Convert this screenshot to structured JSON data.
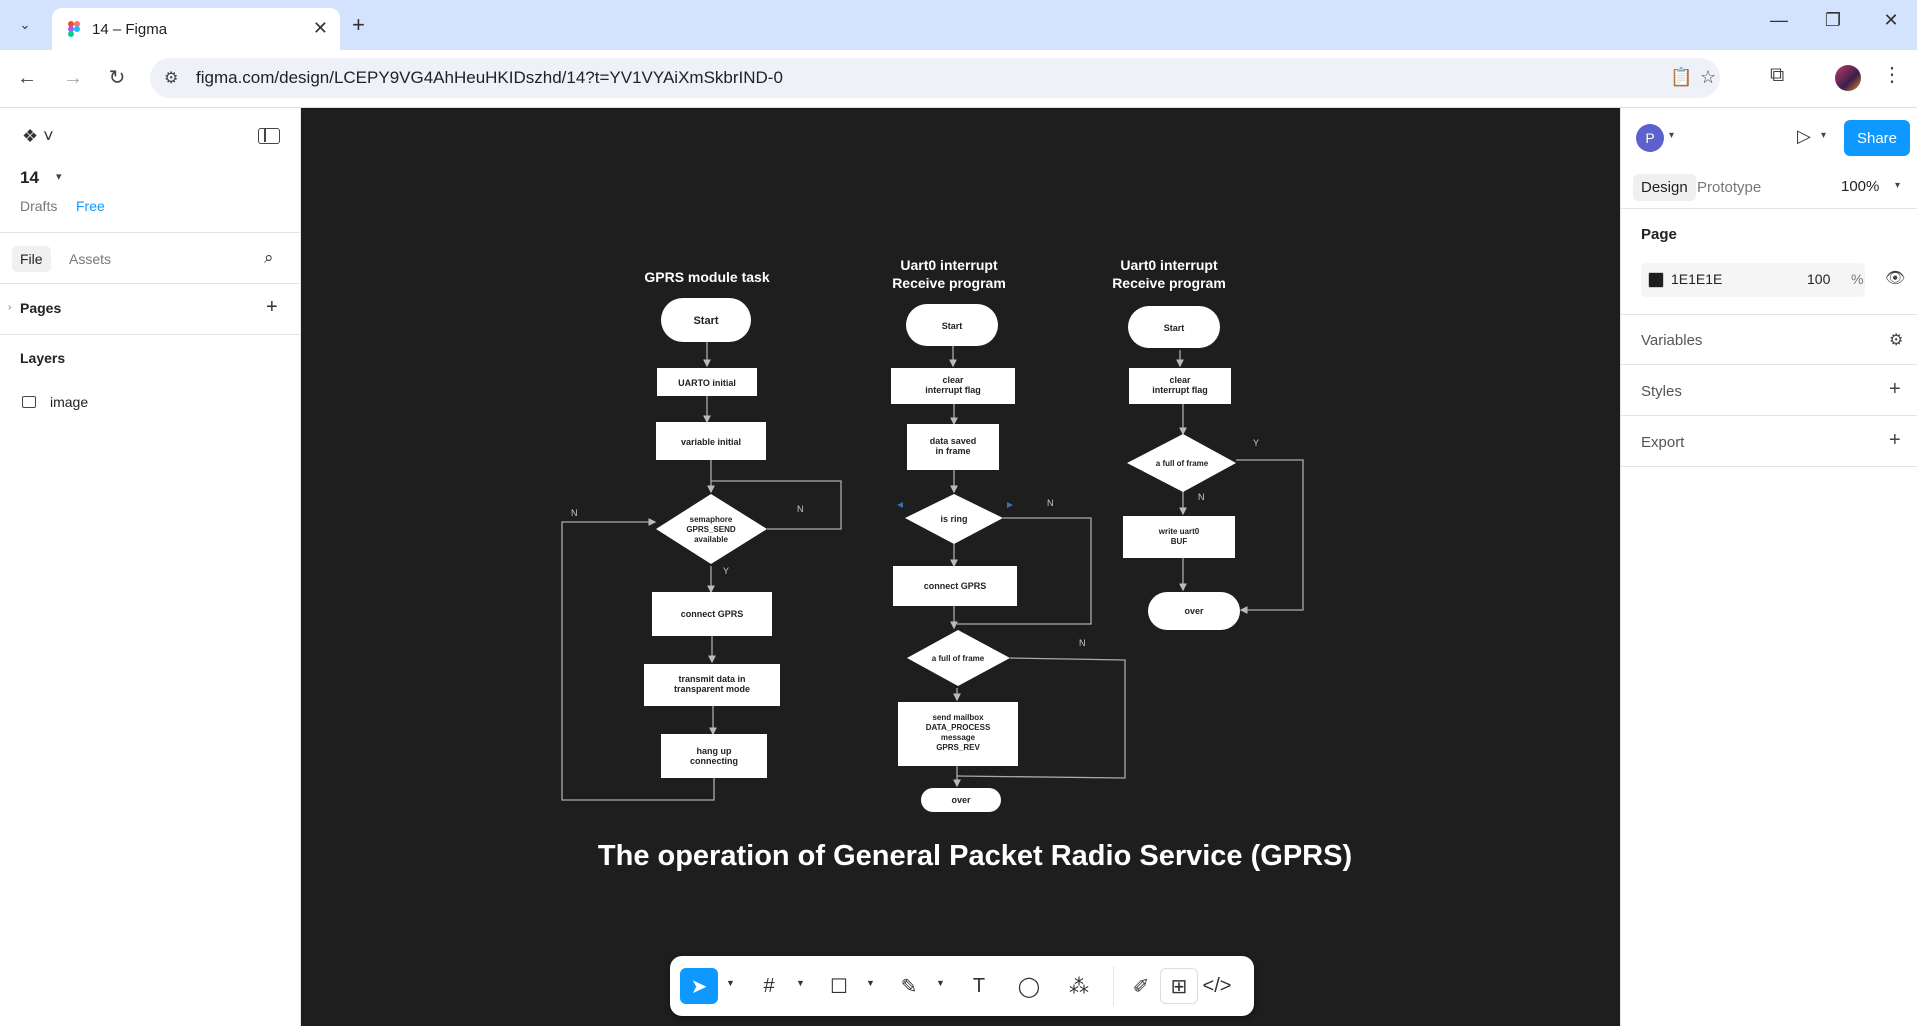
{
  "browser": {
    "tab_title": "14 – Figma",
    "url": "figma.com/design/LCEPY9VG4AhHeuHKIDszhd/14?t=YV1VYAiXmSkbrIND-0"
  },
  "left_panel": {
    "file_name": "14",
    "location": "Drafts",
    "plan": "Free",
    "tabs": [
      "File",
      "Assets"
    ],
    "pages_label": "Pages",
    "layers_label": "Layers",
    "layers": [
      "image"
    ]
  },
  "right_panel": {
    "avatar_initial": "P",
    "share_label": "Share",
    "tabs": [
      "Design",
      "Prototype"
    ],
    "zoom": "100%",
    "page_section": "Page",
    "page_color_hex": "1E1E1E",
    "page_color_opacity": "100",
    "percent_sign": "%",
    "sections": [
      "Variables",
      "Styles",
      "Export"
    ]
  },
  "flowchart": {
    "caption": "The operation of General Packet Radio Service (GPRS)",
    "col1": {
      "title": "GPRS module task",
      "start": "Start",
      "steps": [
        "UARTO initial",
        "variable initial"
      ],
      "decision": [
        "semaphore",
        "GPRS_SEND",
        "available"
      ],
      "after": [
        "connect GPRS"
      ],
      "transmit": [
        "transmit data in",
        "transparent mode"
      ],
      "hangup": [
        "hang up",
        "connecting"
      ],
      "label_n": "N",
      "label_y": "Y"
    },
    "col2": {
      "title_line1": "Uart0 interrupt",
      "title_line2": "Receive program",
      "start": "Start",
      "clear": [
        "clear",
        "interrupt flag"
      ],
      "saved": [
        "data saved",
        "in frame"
      ],
      "decision1": "is ring",
      "connect": "connect GPRS",
      "decision2": "a full of frame",
      "mailbox": [
        "send mailbox",
        "DATA_PROCESS",
        "message",
        "GPRS_REV"
      ],
      "end": "over",
      "label_n": "N"
    },
    "col3": {
      "title_line1": "Uart0 interrupt",
      "title_line2": "Receive program",
      "start": "Start",
      "clear": [
        "clear",
        "interrupt flag"
      ],
      "decision": "a full of frame",
      "write": [
        "write uart0",
        "BUF"
      ],
      "end": "over",
      "label_y": "Y",
      "label_n": "N"
    }
  }
}
